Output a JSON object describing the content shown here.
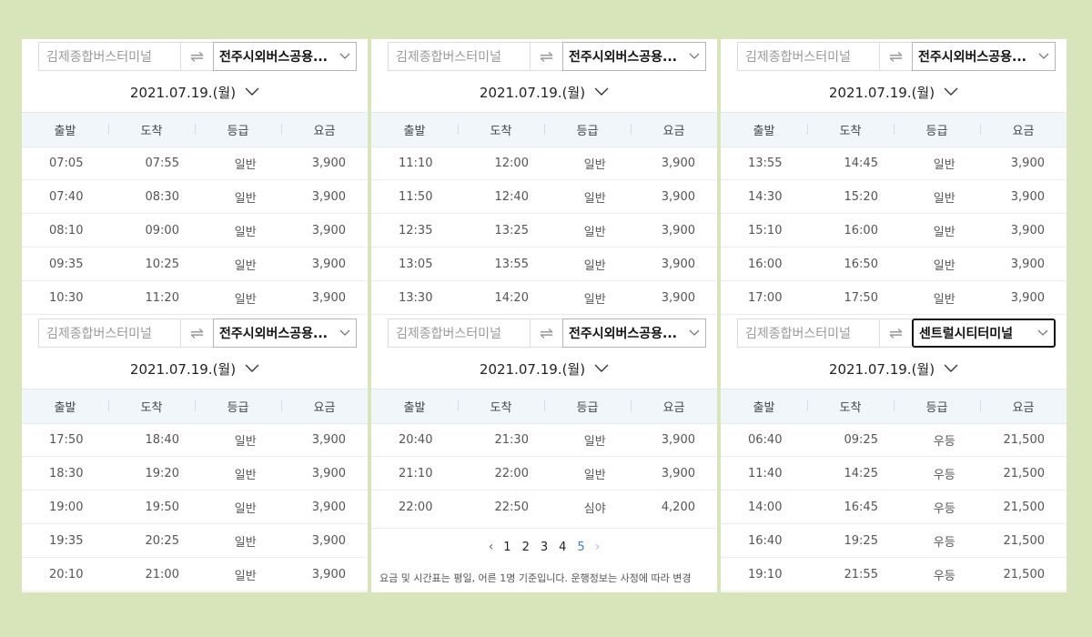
{
  "panels": [
    {
      "origin_placeholder": "김제종합버스터미널",
      "destination": "전주시외버스공용...",
      "date": "2021.07.19.(월)",
      "headers": [
        "출발",
        "도착",
        "등급",
        "요금"
      ],
      "rows": [
        [
          "07:05",
          "07:55",
          "일반",
          "3,900"
        ],
        [
          "07:40",
          "08:30",
          "일반",
          "3,900"
        ],
        [
          "08:10",
          "09:00",
          "일반",
          "3,900"
        ],
        [
          "09:35",
          "10:25",
          "일반",
          "3,900"
        ],
        [
          "10:30",
          "11:20",
          "일반",
          "3,900"
        ]
      ]
    },
    {
      "origin_placeholder": "김제종합버스터미널",
      "destination": "전주시외버스공용...",
      "date": "2021.07.19.(월)",
      "headers": [
        "출발",
        "도착",
        "등급",
        "요금"
      ],
      "rows": [
        [
          "11:10",
          "12:00",
          "일반",
          "3,900"
        ],
        [
          "11:50",
          "12:40",
          "일반",
          "3,900"
        ],
        [
          "12:35",
          "13:25",
          "일반",
          "3,900"
        ],
        [
          "13:05",
          "13:55",
          "일반",
          "3,900"
        ],
        [
          "13:30",
          "14:20",
          "일반",
          "3,900"
        ]
      ]
    },
    {
      "origin_placeholder": "김제종합버스터미널",
      "destination": "전주시외버스공용...",
      "date": "2021.07.19.(월)",
      "headers": [
        "출발",
        "도착",
        "등급",
        "요금"
      ],
      "rows": [
        [
          "13:55",
          "14:45",
          "일반",
          "3,900"
        ],
        [
          "14:30",
          "15:20",
          "일반",
          "3,900"
        ],
        [
          "15:10",
          "16:00",
          "일반",
          "3,900"
        ],
        [
          "16:00",
          "16:50",
          "일반",
          "3,900"
        ],
        [
          "17:00",
          "17:50",
          "일반",
          "3,900"
        ]
      ]
    },
    {
      "origin_placeholder": "김제종합버스터미널",
      "destination": "전주시외버스공용...",
      "date": "2021.07.19.(월)",
      "headers": [
        "출발",
        "도착",
        "등급",
        "요금"
      ],
      "rows": [
        [
          "17:50",
          "18:40",
          "일반",
          "3,900"
        ],
        [
          "18:30",
          "19:20",
          "일반",
          "3,900"
        ],
        [
          "19:00",
          "19:50",
          "일반",
          "3,900"
        ],
        [
          "19:35",
          "20:25",
          "일반",
          "3,900"
        ],
        [
          "20:10",
          "21:00",
          "일반",
          "3,900"
        ]
      ]
    },
    {
      "origin_placeholder": "김제종합버스터미널",
      "destination": "전주시외버스공용...",
      "date": "2021.07.19.(월)",
      "headers": [
        "출발",
        "도착",
        "등급",
        "요금"
      ],
      "rows": [
        [
          "20:40",
          "21:30",
          "일반",
          "3,900"
        ],
        [
          "21:10",
          "22:00",
          "일반",
          "3,900"
        ],
        [
          "22:00",
          "22:50",
          "심야",
          "4,200"
        ]
      ],
      "pagination": {
        "prev": "‹",
        "pages": [
          "1",
          "2",
          "3",
          "4",
          "5"
        ],
        "current": "5",
        "next": "›"
      },
      "notice": "요금 및 시간표는 평일, 어른 1명 기준입니다. 운행정보는 사정에 따라 변경"
    },
    {
      "origin_placeholder": "김제종합버스터미널",
      "destination": "센트럴시티터미널",
      "date": "2021.07.19.(월)",
      "headers": [
        "출발",
        "도착",
        "등급",
        "요금"
      ],
      "rows": [
        [
          "06:40",
          "09:25",
          "우등",
          "21,500"
        ],
        [
          "11:40",
          "14:25",
          "우등",
          "21,500"
        ],
        [
          "14:00",
          "16:45",
          "우등",
          "21,500"
        ],
        [
          "16:40",
          "19:25",
          "우등",
          "21,500"
        ],
        [
          "19:10",
          "21:55",
          "우등",
          "21,500"
        ]
      ]
    }
  ],
  "icons": {
    "swap": "swap-arrows-icon",
    "dropdown": "chevron-down-icon",
    "date_picker": "chevron-down-icon"
  },
  "colors": {
    "background": "#d8e4ba",
    "table_header": "#f1f6fa",
    "current_page": "#2f7fe0"
  }
}
